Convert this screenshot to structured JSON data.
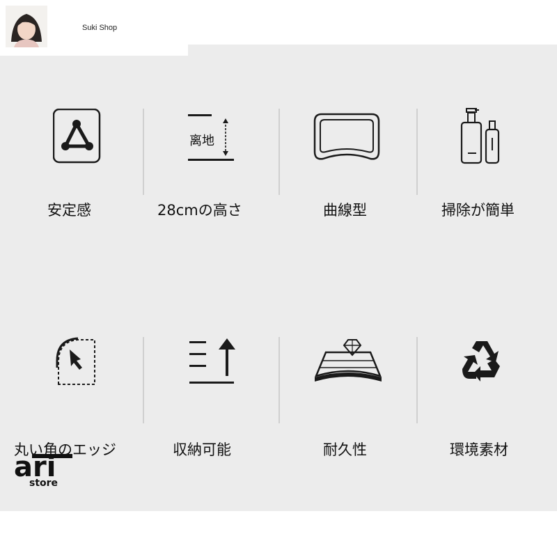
{
  "shop": {
    "name": "Suki Shop",
    "avatar_icon": "avatar"
  },
  "features": [
    {
      "label": "安定感",
      "icon": "triangle-stability-icon"
    },
    {
      "label": "28cmの高さ",
      "icon": "height-measure-icon",
      "icon_text": "离地"
    },
    {
      "label": "曲線型",
      "icon": "curved-tray-icon"
    },
    {
      "label": "掃除が簡単",
      "icon": "bottles-icon"
    },
    {
      "label": "丸い角のエッジ",
      "icon": "rounded-corner-icon"
    },
    {
      "label": "収納可能",
      "icon": "storage-lines-arrow-icon"
    },
    {
      "label": "耐久性",
      "icon": "diamond-shelf-icon"
    },
    {
      "label": "環境素材",
      "icon": "recycle-icon"
    }
  ],
  "logo": {
    "text_main": "ari",
    "text_sub": "store"
  },
  "colors": {
    "panel": "#ececec",
    "icon": "#1a1a1a",
    "divider": "#cfcfcf"
  }
}
